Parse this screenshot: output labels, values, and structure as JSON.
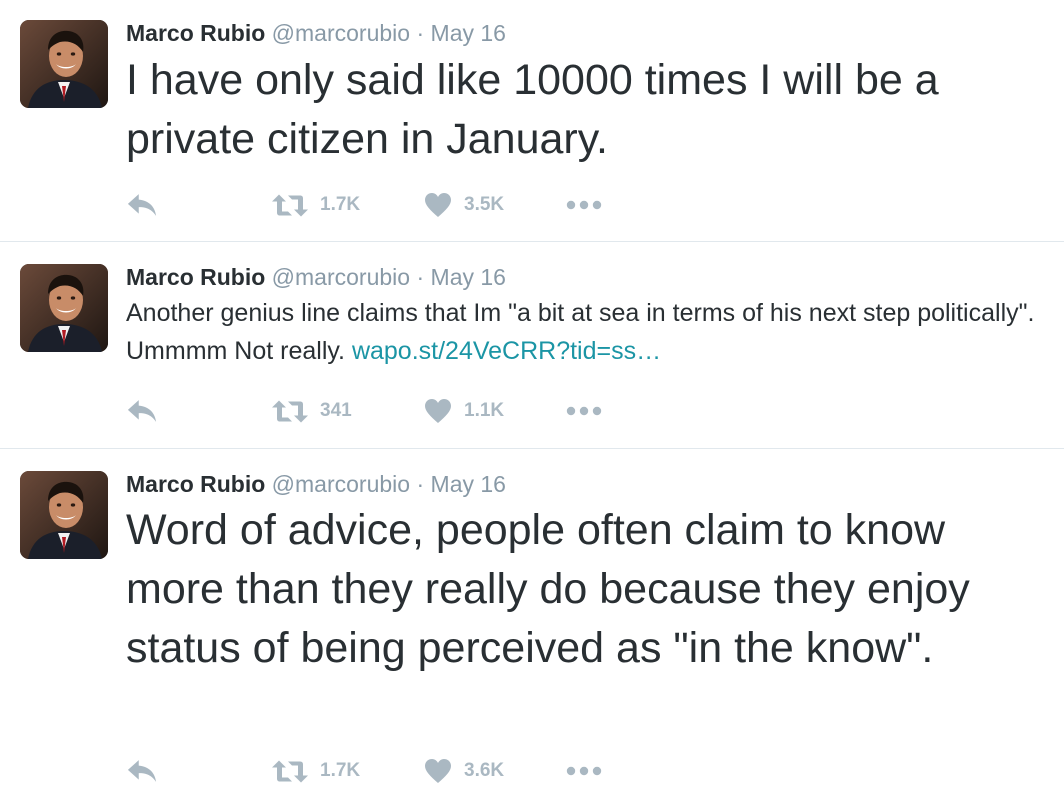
{
  "colors": {
    "name": "#292f33",
    "meta": "#8899a6",
    "link": "#1b95a5",
    "action_icon": "#aab8c2",
    "divider": "#e1e8ed"
  },
  "icons": {
    "reply": "reply-icon",
    "retweet": "retweet-icon",
    "like": "heart-icon",
    "more": "more-dots-icon"
  },
  "tweets": [
    {
      "name": "Marco Rubio",
      "handle": "@marcorubio",
      "separator": "·",
      "date": "May 16",
      "text": "I have only said like 10000 times I will be a private citizen in January.",
      "link": "",
      "retweets": "1.7K",
      "likes": "3.5K"
    },
    {
      "name": "Marco Rubio",
      "handle": "@marcorubio",
      "separator": "·",
      "date": "May 16",
      "text": "Another genius line claims that Im \"a bit at sea in terms of his next step politically\". Ummmm Not really. ",
      "link": "wapo.st/24VeCRR?tid=ss…",
      "retweets": "341",
      "likes": "1.1K"
    },
    {
      "name": "Marco Rubio",
      "handle": "@marcorubio",
      "separator": "·",
      "date": "May 16",
      "text": "Word of advice, people often claim to know more than they really do because they enjoy status of being perceived as \"in the know\".",
      "link": "",
      "retweets": "1.7K",
      "likes": "3.6K"
    }
  ]
}
